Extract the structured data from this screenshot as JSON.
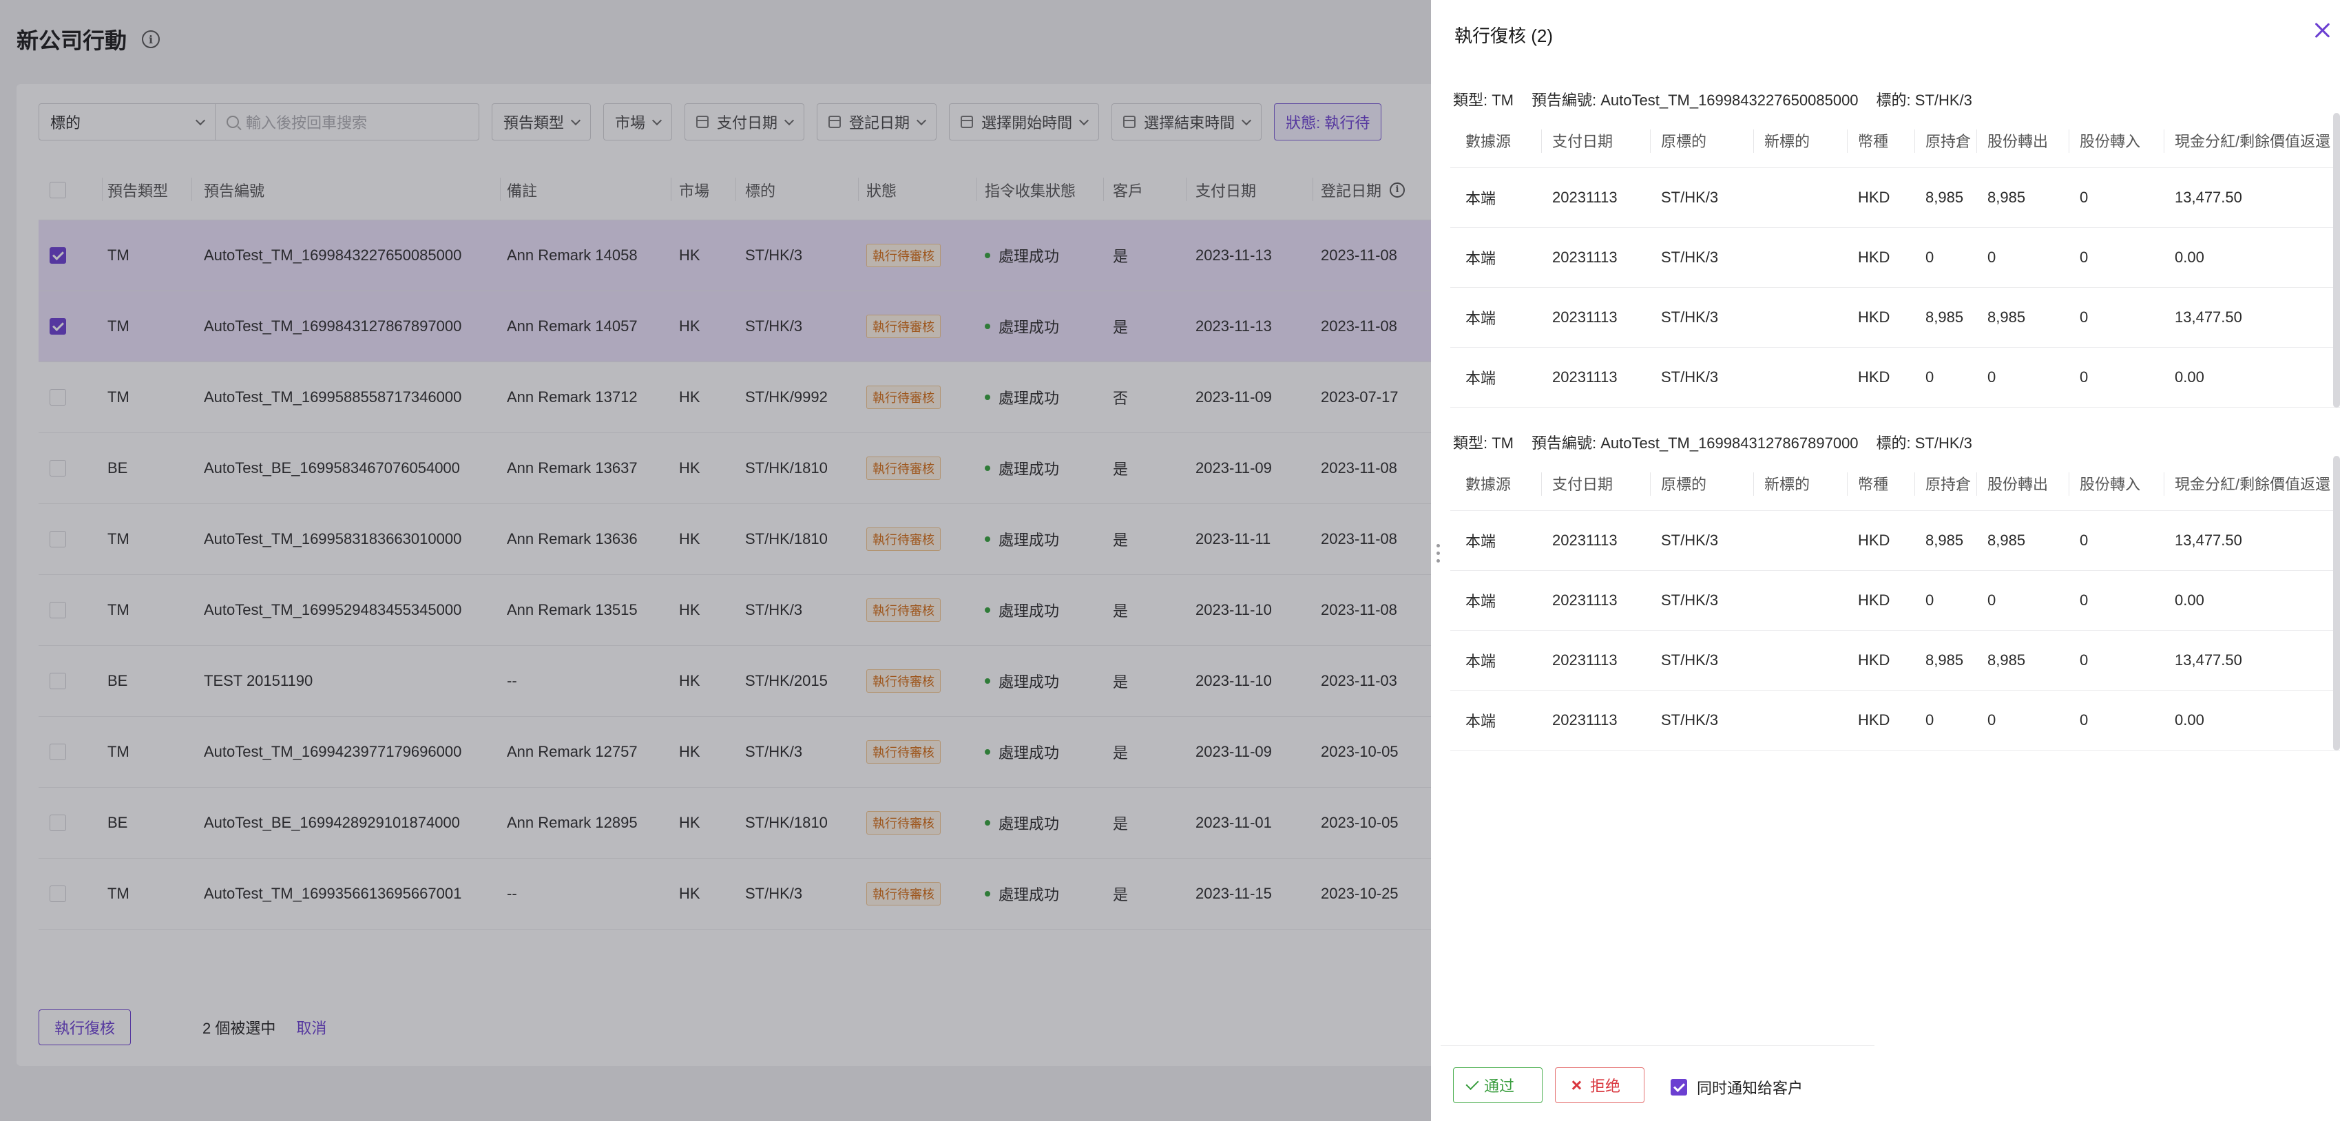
{
  "page": {
    "title": "新公司行動",
    "filters": {
      "symbol_select": "標的",
      "search_placeholder": "輸入後按回車搜索",
      "announcement_type": "預告類型",
      "market": "市場",
      "pay_date": "支付日期",
      "record_date": "登記日期",
      "start_time": "選擇開始時間",
      "end_time": "選擇結束時間",
      "status": "狀態: 執行待"
    },
    "columns": [
      "預告類型",
      "預告編號",
      "備註",
      "市場",
      "標的",
      "狀態",
      "指令收集狀態",
      "客戶",
      "支付日期",
      "登記日期"
    ],
    "rows": [
      {
        "checked": true,
        "type": "TM",
        "id": "AutoTest_TM_1699843227650085000",
        "remark": "Ann Remark 14058",
        "market": "HK",
        "symbol": "ST/HK/3",
        "status": "執行待審核",
        "collect": "處理成功",
        "client": "是",
        "pay": "2023-11-13",
        "record": "2023-11-08"
      },
      {
        "checked": true,
        "type": "TM",
        "id": "AutoTest_TM_1699843127867897000",
        "remark": "Ann Remark 14057",
        "market": "HK",
        "symbol": "ST/HK/3",
        "status": "執行待審核",
        "collect": "處理成功",
        "client": "是",
        "pay": "2023-11-13",
        "record": "2023-11-08"
      },
      {
        "checked": false,
        "type": "TM",
        "id": "AutoTest_TM_1699588558717346000",
        "remark": "Ann Remark 13712",
        "market": "HK",
        "symbol": "ST/HK/9992",
        "status": "執行待審核",
        "collect": "處理成功",
        "client": "否",
        "pay": "2023-11-09",
        "record": "2023-07-17"
      },
      {
        "checked": false,
        "type": "BE",
        "id": "AutoTest_BE_1699583467076054000",
        "remark": "Ann Remark 13637",
        "market": "HK",
        "symbol": "ST/HK/1810",
        "status": "執行待審核",
        "collect": "處理成功",
        "client": "是",
        "pay": "2023-11-09",
        "record": "2023-11-08"
      },
      {
        "checked": false,
        "type": "TM",
        "id": "AutoTest_TM_1699583183663010000",
        "remark": "Ann Remark 13636",
        "market": "HK",
        "symbol": "ST/HK/1810",
        "status": "執行待審核",
        "collect": "處理成功",
        "client": "是",
        "pay": "2023-11-11",
        "record": "2023-11-08"
      },
      {
        "checked": false,
        "type": "TM",
        "id": "AutoTest_TM_1699529483455345000",
        "remark": "Ann Remark 13515",
        "market": "HK",
        "symbol": "ST/HK/3",
        "status": "執行待審核",
        "collect": "處理成功",
        "client": "是",
        "pay": "2023-11-10",
        "record": "2023-11-08"
      },
      {
        "checked": false,
        "type": "BE",
        "id": "TEST 20151190",
        "remark": "--",
        "market": "HK",
        "symbol": "ST/HK/2015",
        "status": "執行待審核",
        "collect": "處理成功",
        "client": "是",
        "pay": "2023-11-10",
        "record": "2023-11-03"
      },
      {
        "checked": false,
        "type": "TM",
        "id": "AutoTest_TM_1699423977179696000",
        "remark": "Ann Remark 12757",
        "market": "HK",
        "symbol": "ST/HK/3",
        "status": "執行待審核",
        "collect": "處理成功",
        "client": "是",
        "pay": "2023-11-09",
        "record": "2023-10-05"
      },
      {
        "checked": false,
        "type": "BE",
        "id": "AutoTest_BE_1699428929101874000",
        "remark": "Ann Remark 12895",
        "market": "HK",
        "symbol": "ST/HK/1810",
        "status": "執行待審核",
        "collect": "處理成功",
        "client": "是",
        "pay": "2023-11-01",
        "record": "2023-10-05"
      },
      {
        "checked": false,
        "type": "TM",
        "id": "AutoTest_TM_1699356613695667001",
        "remark": "--",
        "market": "HK",
        "symbol": "ST/HK/3",
        "status": "執行待審核",
        "collect": "處理成功",
        "client": "是",
        "pay": "2023-11-15",
        "record": "2023-10-25"
      }
    ],
    "bottom": {
      "execute_review": "執行復核",
      "selected_count": "2 個被選中",
      "cancel": "取消"
    }
  },
  "drawer": {
    "title": "執行復核 (2)",
    "columns": [
      "數據源",
      "支付日期",
      "原標的",
      "新標的",
      "幣種",
      "原持倉",
      "股份轉出",
      "股份轉入",
      "現金分紅/剩餘價值返還"
    ],
    "groups": [
      {
        "type_label": "類型: TM",
        "id_label": "預告編號: AutoTest_TM_1699843227650085000",
        "symbol_label": "標的: ST/HK/3",
        "rows": [
          [
            "本端",
            "20231113",
            "ST/HK/3",
            "",
            "HKD",
            "8,985",
            "8,985",
            "0",
            "13,477.50"
          ],
          [
            "本端",
            "20231113",
            "ST/HK/3",
            "",
            "HKD",
            "0",
            "0",
            "0",
            "0.00"
          ],
          [
            "本端",
            "20231113",
            "ST/HK/3",
            "",
            "HKD",
            "8,985",
            "8,985",
            "0",
            "13,477.50"
          ],
          [
            "本端",
            "20231113",
            "ST/HK/3",
            "",
            "HKD",
            "0",
            "0",
            "0",
            "0.00"
          ]
        ]
      },
      {
        "type_label": "類型: TM",
        "id_label": "預告編號: AutoTest_TM_1699843127867897000",
        "symbol_label": "標的: ST/HK/3",
        "rows": [
          [
            "本端",
            "20231113",
            "ST/HK/3",
            "",
            "HKD",
            "8,985",
            "8,985",
            "0",
            "13,477.50"
          ],
          [
            "本端",
            "20231113",
            "ST/HK/3",
            "",
            "HKD",
            "0",
            "0",
            "0",
            "0.00"
          ],
          [
            "本端",
            "20231113",
            "ST/HK/3",
            "",
            "HKD",
            "8,985",
            "8,985",
            "0",
            "13,477.50"
          ],
          [
            "本端",
            "20231113",
            "ST/HK/3",
            "",
            "HKD",
            "0",
            "0",
            "0",
            "0.00"
          ]
        ]
      }
    ],
    "footer": {
      "pass": "通过",
      "reject": "拒绝",
      "notify_label": "同时通知给客户",
      "notify_checked": true
    }
  }
}
